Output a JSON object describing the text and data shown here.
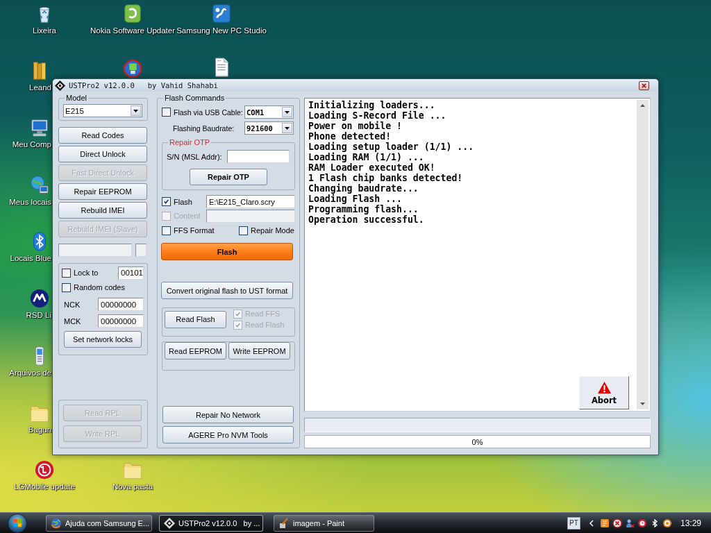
{
  "desktop": {
    "icons": [
      {
        "label": "Lixeira"
      },
      {
        "label": "Nokia Software Updater"
      },
      {
        "label": "Samsung New PC Studio"
      },
      {
        "label": "Leand"
      },
      {
        "label": "Meu Comp"
      },
      {
        "label": "Meus locais"
      },
      {
        "label": "Locais Blue"
      },
      {
        "label": "RSD Li"
      },
      {
        "label": "Arquivos de"
      },
      {
        "label": "Bagun"
      },
      {
        "label": "LGMobile update"
      },
      {
        "label": "Nova pasta"
      }
    ]
  },
  "window": {
    "title": "USTPro2 v12.0.0   by Vahid Shahabi",
    "model": {
      "legend": "Model",
      "value": "E215"
    },
    "left_buttons": [
      {
        "label": "Read Codes",
        "disabled": false
      },
      {
        "label": "Direct Unlock",
        "disabled": false
      },
      {
        "label": "Fast Direct Unlock",
        "disabled": true
      },
      {
        "label": "Repair EEPROM",
        "disabled": false
      },
      {
        "label": "Rebuild IMEI",
        "disabled": false
      },
      {
        "label": "Rebuild IMEI (Slave)",
        "disabled": true
      }
    ],
    "network_locks": {
      "lock_to": {
        "label": "Lock to",
        "checked": false,
        "value": "00101"
      },
      "random_codes": {
        "label": "Random codes",
        "checked": false
      },
      "codes": [
        {
          "label": "NCK",
          "value": "00000000"
        },
        {
          "label": "MCK",
          "value": "00000000"
        }
      ],
      "button": "Set network locks"
    },
    "rpl_buttons": [
      {
        "label": "Read RPL",
        "disabled": true
      },
      {
        "label": "Write RPL",
        "disabled": true
      }
    ],
    "flash_commands": {
      "legend": "Flash Commands",
      "usb_cable": {
        "label": "Flash via USB Cable:",
        "checked": false,
        "port": "COM1"
      },
      "baudrate": {
        "label": "Flashing Baudrate:",
        "value": "921600"
      },
      "repair_otp": {
        "legend": "Repair OTP",
        "sn_label": "S/N (MSL Addr):",
        "button": "Repair OTP"
      },
      "files": [
        {
          "label": "Flash",
          "checked": true,
          "disabled": false,
          "path": "E:\\E215_Claro.scry"
        },
        {
          "label": "Content",
          "checked": false,
          "disabled": true
        }
      ],
      "options": [
        {
          "label": "FFS Format",
          "checked": false
        },
        {
          "label": "Repair Mode",
          "checked": false
        }
      ],
      "flash_button": "Flash",
      "convert_button": "Convert original flash to UST format",
      "read_flash": {
        "button": "Read Flash",
        "options": [
          {
            "label": "Read FFS",
            "checked": true,
            "disabled": true
          },
          {
            "label": "Read Flash",
            "checked": true,
            "disabled": true
          }
        ]
      },
      "eeprom_buttons": [
        "Read EEPROM",
        "Write EEPROM"
      ],
      "bottom_buttons": [
        "Repair No Network",
        "AGERE Pro NVM Tools"
      ]
    },
    "log": {
      "lines": [
        "Initializing loaders...",
        "Loading S-Record File ...",
        "Power on mobile !",
        "Phone detected!",
        "Loading setup loader (1/1) ...",
        "Loading RAM (1/1) ...",
        "RAM Loader executed OK!",
        "1 Flash chip banks detected!",
        "Changing baudrate...",
        "Loading Flash ...",
        "Programming flash...",
        "Operation successful."
      ]
    },
    "abort_button": "Abort",
    "progress": {
      "level": 0,
      "text": "0%"
    }
  },
  "taskbar": {
    "tasks": [
      {
        "label": "Ajuda com Samsung E...",
        "selected": false
      },
      {
        "label": "USTPro2 v12.0.0   by ...",
        "selected": true
      },
      {
        "label": "imagem - Paint",
        "selected": false
      }
    ],
    "language": "PT",
    "time": "13:29"
  }
}
